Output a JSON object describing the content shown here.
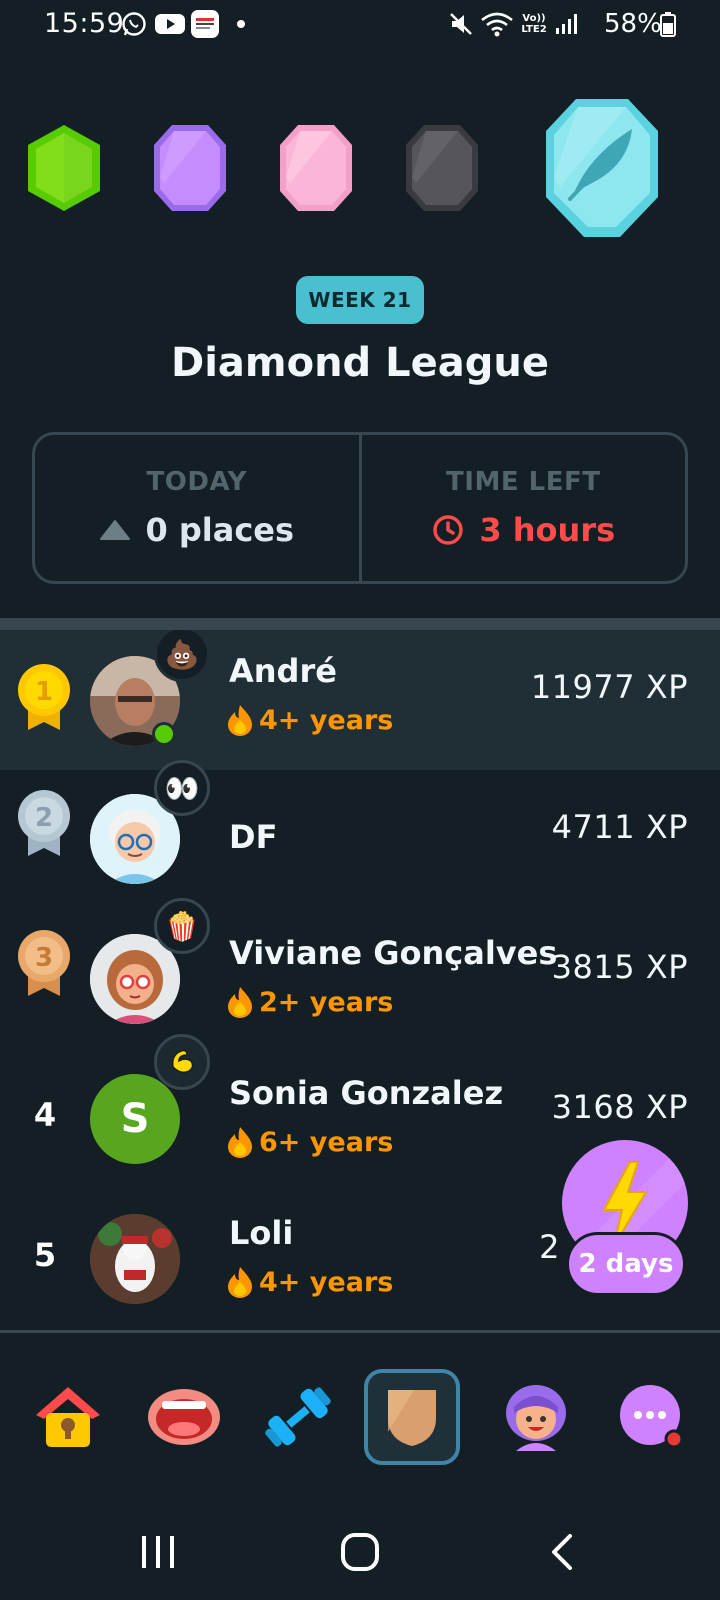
{
  "status_bar": {
    "time": "15:59",
    "battery": "58%",
    "icons": [
      "whatsapp-icon",
      "youtube-icon",
      "notification-app-icon",
      "dot-icon",
      "mute-icon",
      "wifi-icon",
      "volte-icon",
      "signal-icon",
      "battery-icon"
    ]
  },
  "header": {
    "week_label": "WEEK 21",
    "league_title": "Diamond League",
    "league_badges": [
      "emerald",
      "amethyst",
      "pearl",
      "obsidian",
      "diamond"
    ]
  },
  "stats": {
    "today_label": "TODAY",
    "today_value": "0 places",
    "time_left_label": "TIME LEFT",
    "time_left_value": "3 hours"
  },
  "leaderboard": [
    {
      "rank": "1",
      "medal": "gold",
      "name": "André",
      "streak": "4+ years",
      "xp": "11977 XP",
      "badge_icon": "poop-emoji",
      "online": true,
      "highlight": true
    },
    {
      "rank": "2",
      "medal": "silver",
      "name": "DF",
      "streak": "",
      "xp": "4711 XP",
      "badge_icon": "eyes-emoji",
      "online": false,
      "highlight": false
    },
    {
      "rank": "3",
      "medal": "bronze",
      "name": "Viviane Gonçalves",
      "streak": "2+ years",
      "xp": "3815 XP",
      "badge_icon": "popcorn-emoji",
      "online": false,
      "highlight": false
    },
    {
      "rank": "4",
      "medal": "",
      "name": "Sonia Gonzalez",
      "streak": "6+ years",
      "xp": "3168 XP",
      "badge_icon": "flexed-arm-emoji",
      "avatar_letter": "S",
      "online": false,
      "highlight": false
    },
    {
      "rank": "5",
      "medal": "",
      "name": "Loli",
      "streak": "4+ years",
      "xp": "2",
      "badge_icon": "",
      "online": false,
      "highlight": false
    }
  ],
  "boost": {
    "label": "2 days"
  },
  "tabs": [
    {
      "name": "home",
      "icon": "home-icon"
    },
    {
      "name": "speak",
      "icon": "mouth-icon"
    },
    {
      "name": "practice",
      "icon": "dumbbell-icon"
    },
    {
      "name": "leaderboards",
      "icon": "shield-icon",
      "active": true
    },
    {
      "name": "profile",
      "icon": "profile-avatar-icon"
    },
    {
      "name": "more",
      "icon": "more-icon",
      "notification": true
    }
  ],
  "colors": {
    "background": "#131f24",
    "highlight_row": "#202f36",
    "border": "#37464f",
    "week_pill": "#49c0d0",
    "streak": "#ff9600",
    "time_left": "#ff4b4b",
    "boost": "#ce82ff"
  }
}
